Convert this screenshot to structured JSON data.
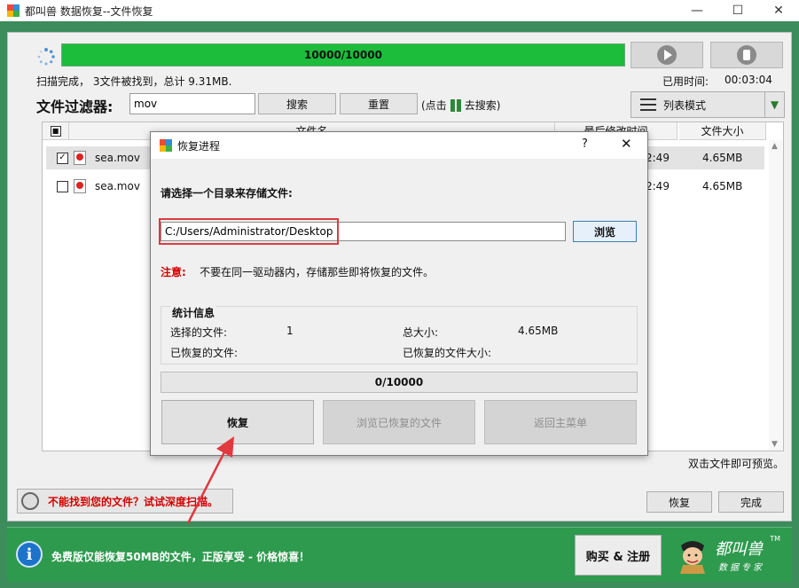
{
  "window": {
    "title": "都叫兽 数据恢复--文件恢复",
    "controls": {
      "minimize": "—",
      "maximize": "☐",
      "close": "✕"
    }
  },
  "scan": {
    "progress_text": "10000/10000",
    "progress_fraction": 1.0,
    "status_text": "扫描完成，  3文件被找到，总计 9.31MB.",
    "elapsed_label": "已用时间:",
    "elapsed_value": "00:03:04"
  },
  "filter": {
    "label": "文件过滤器:",
    "value": "mov",
    "search_label": "搜索",
    "reset_label": "重置",
    "hint_prefix": "(点击",
    "hint_suffix": "去搜索)",
    "view_mode_label": "列表模式",
    "dropdown_arrow": "▼"
  },
  "table": {
    "headers": {
      "name": "文件名",
      "modified": "最后修改时间",
      "size": "文件大小"
    },
    "rows": [
      {
        "checked": true,
        "check_mark": "✓",
        "name": "sea.mov",
        "modified": "2:49",
        "size": "4.65MB"
      },
      {
        "checked": false,
        "check_mark": "",
        "name": "sea.mov",
        "modified": "2:49",
        "size": "4.65MB"
      }
    ],
    "scroll_up": "▲",
    "scroll_down": "▼"
  },
  "dblclick_hint": "双击文件即可预览。",
  "deep_scan_label": "不能找到您的文件？试试深度扫描。",
  "footer_buttons": {
    "recover": "恢复",
    "finish": "完成"
  },
  "bottom_bar": {
    "info_glyph": "i",
    "message": "免费版仅能恢复50MB的文件，正版享受 - 价格惊喜！",
    "buy_label": "购买 & 注册",
    "logo_name": "都叫兽",
    "logo_sub": "数据专家",
    "logo_tm": "TM"
  },
  "dialog": {
    "title": "恢复进程",
    "help_glyph": "?",
    "close_glyph": "✕",
    "prompt": "请选择一个目录来存储文件:",
    "path_value": "C:/Users/Administrator/Desktop",
    "browse_label": "浏览",
    "note_key": "注意:",
    "note_text": "不要在同一驱动器内，存储那些即将恢复的文件。",
    "stats": {
      "legend": "统计信息",
      "selected_files_label": "选择的文件:",
      "selected_files_value": "1",
      "total_size_label": "总大小:",
      "total_size_value": "4.65MB",
      "recovered_files_label": "已恢复的文件:",
      "recovered_size_label": "已恢复的文件大小:"
    },
    "progress_text": "0/10000",
    "buttons": {
      "recover": "恢复",
      "browse_recovered": "浏览已恢复的文件",
      "back_to_menu": "返回主菜单"
    }
  },
  "colors": {
    "accent_green": "#2e9a4e",
    "progress_green": "#1bbd3a",
    "highlight_red": "#e0393e",
    "warning_red": "#d40000"
  }
}
